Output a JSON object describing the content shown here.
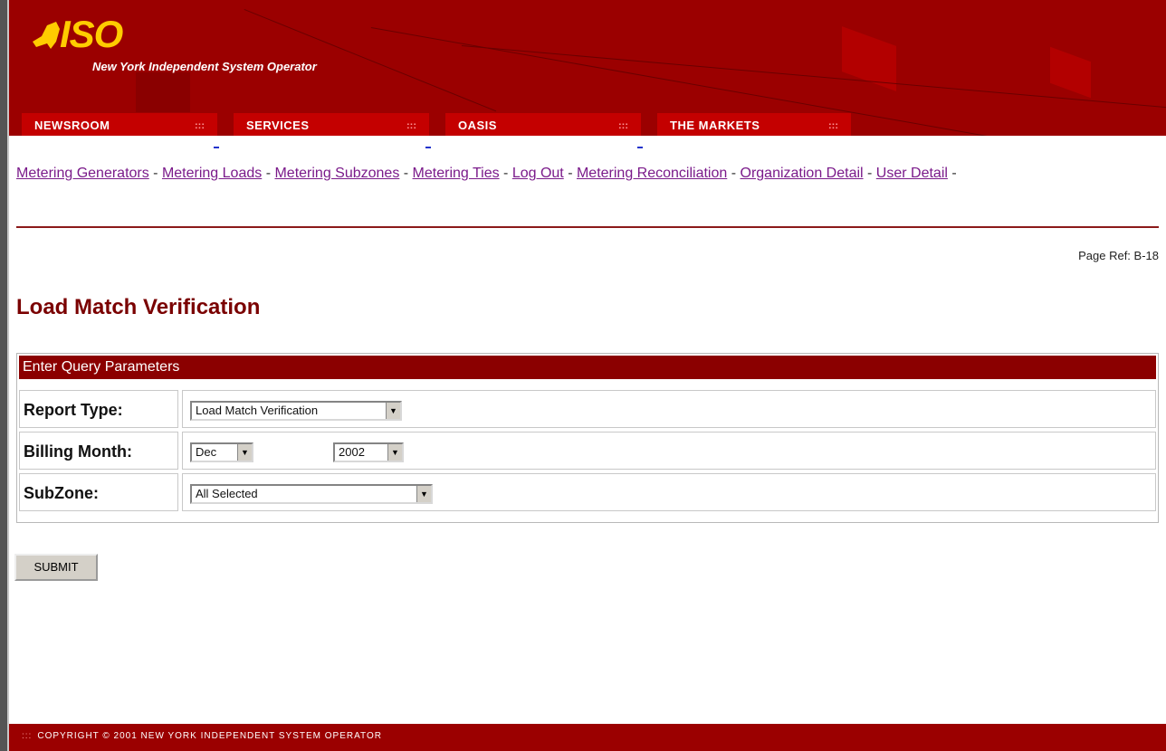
{
  "brand": {
    "logo_text": "ISO",
    "org_name": "New York Independent System Operator",
    "logo_color": "#ffcc00",
    "header_color": "#9b0000"
  },
  "nav": {
    "tabs": [
      {
        "label": "NEWSROOM"
      },
      {
        "label": "SERVICES"
      },
      {
        "label": "OASIS"
      },
      {
        "label": "THE MARKETS"
      }
    ],
    "tab_dots": ":::"
  },
  "links": [
    {
      "label": "Metering Generators"
    },
    {
      "label": "Metering Loads"
    },
    {
      "label": "Metering Subzones"
    },
    {
      "label": "Metering Ties"
    },
    {
      "label": "Log Out"
    },
    {
      "label": "Metering Reconciliation"
    },
    {
      "label": "Organization Detail"
    },
    {
      "label": "User Detail"
    }
  ],
  "link_separator": " - ",
  "page_ref": "Page Ref: B-18",
  "page_title": "Load Match Verification",
  "form": {
    "header": "Enter Query Parameters",
    "rows": [
      {
        "label": "Report Type:",
        "value": "Load Match Verification"
      },
      {
        "label": "Billing Month:",
        "month": "Dec",
        "year": "2002"
      },
      {
        "label": "SubZone:",
        "value": "All Selected"
      }
    ],
    "submit_label": "SUBMIT"
  },
  "footer": {
    "dots": ":::",
    "text": "COPYRIGHT © 2001 NEW YORK INDEPENDENT SYSTEM OPERATOR"
  }
}
